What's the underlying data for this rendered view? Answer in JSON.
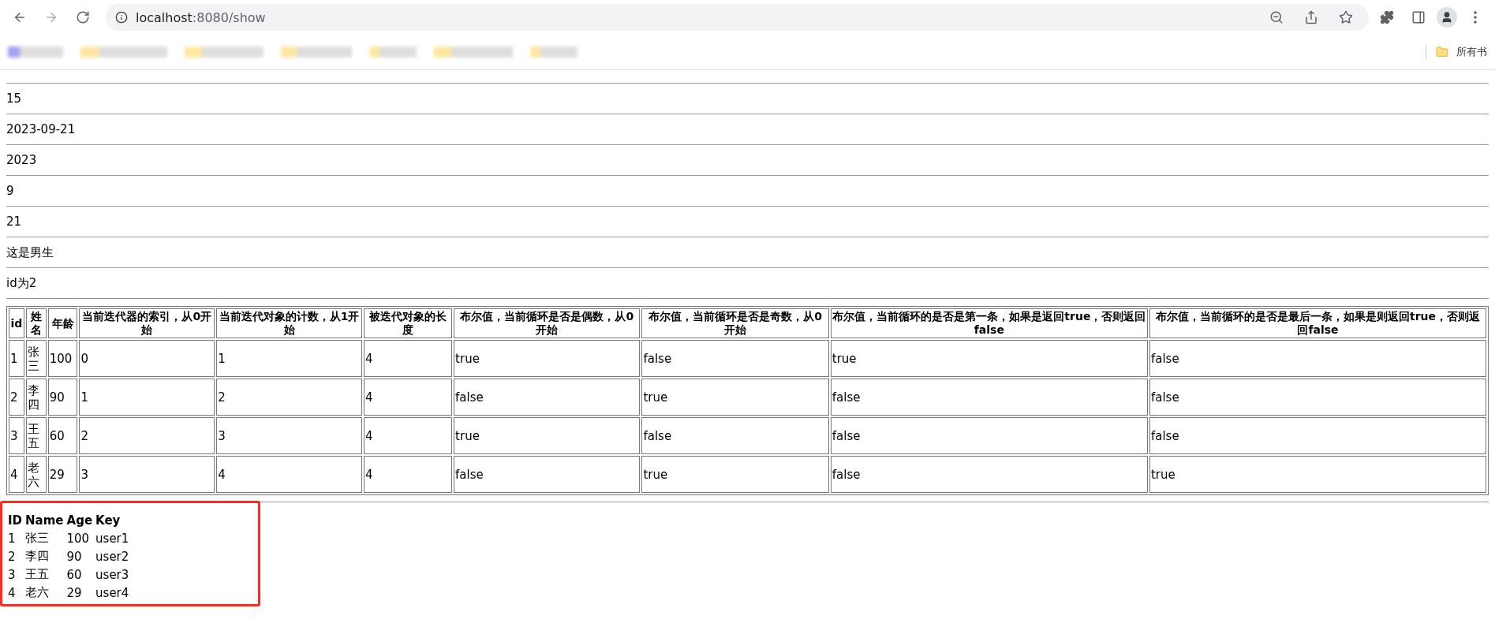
{
  "browser": {
    "url_host": "localhost",
    "url_rest": ":8080/show",
    "bookmarks_folder": "所有书"
  },
  "values": [
    "15",
    "2023-09-21",
    "2023",
    "9",
    "21",
    "这是男生",
    "id为2"
  ],
  "loop_table": {
    "columns": [
      "id",
      "姓名",
      "年龄",
      "当前迭代器的索引，从0开始",
      "当前迭代对象的计数，从1开始",
      "被迭代对象的长度",
      "布尔值，当前循环是否是偶数，从0开始",
      "布尔值，当前循环是否是奇数，从0开始",
      "布尔值，当前循环的是否是第一条，如果是返回true，否则返回false",
      "布尔值，当前循环的是否是最后一条，如果是则返回true，否则返回false"
    ],
    "rows": [
      [
        "1",
        "张三",
        "100",
        "0",
        "1",
        "4",
        "true",
        "false",
        "true",
        "false"
      ],
      [
        "2",
        "李四",
        "90",
        "1",
        "2",
        "4",
        "false",
        "true",
        "false",
        "false"
      ],
      [
        "3",
        "王五",
        "60",
        "2",
        "3",
        "4",
        "true",
        "false",
        "false",
        "false"
      ],
      [
        "4",
        "老六",
        "29",
        "3",
        "4",
        "4",
        "false",
        "true",
        "false",
        "true"
      ]
    ]
  },
  "user_table": {
    "columns": [
      "ID",
      "Name",
      "Age",
      "Key"
    ],
    "rows": [
      [
        "1",
        "张三",
        "100",
        "user1"
      ],
      [
        "2",
        "李四",
        "90",
        "user2"
      ],
      [
        "3",
        "王五",
        "60",
        "user3"
      ],
      [
        "4",
        "老六",
        "29",
        "user4"
      ]
    ]
  }
}
